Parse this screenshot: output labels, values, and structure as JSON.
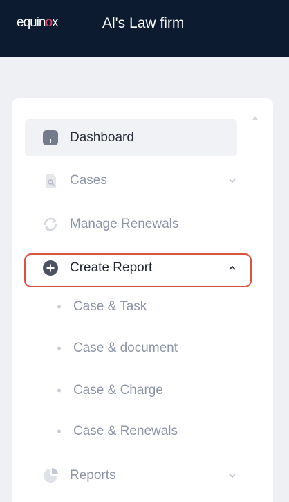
{
  "header": {
    "logo_text": "equinox",
    "firm_name": "Al's Law firm"
  },
  "colors": {
    "topbar": "#0d1b30",
    "highlight_border": "#d9533f",
    "active_bg": "#f1f2f5"
  },
  "nav": {
    "dashboard": {
      "label": "Dashboard",
      "icon": "dashboard-icon"
    },
    "cases": {
      "label": "Cases",
      "icon": "cases-icon"
    },
    "manage_renewals": {
      "label": "Manage Renewals",
      "icon": "refresh-icon"
    },
    "create_report": {
      "label": "Create Report",
      "icon": "plus-circle-icon",
      "children": [
        {
          "label": "Case & Task"
        },
        {
          "label": "Case & document"
        },
        {
          "label": "Case & Charge"
        },
        {
          "label": "Case & Renewals"
        }
      ]
    },
    "reports": {
      "label": "Reports",
      "icon": "pie-chart-icon"
    }
  }
}
